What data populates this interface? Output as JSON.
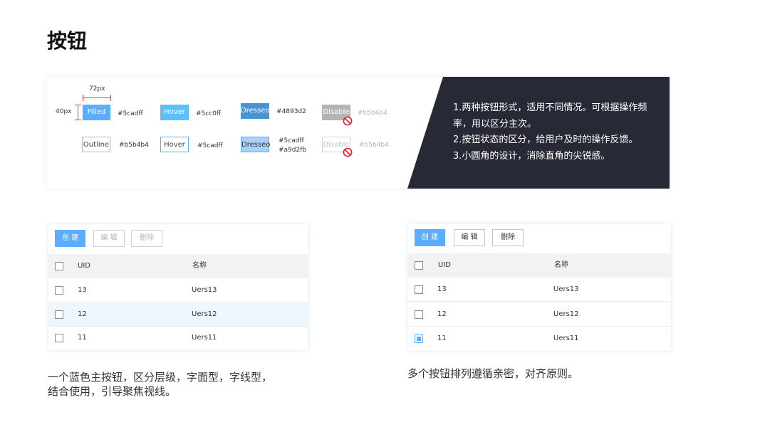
{
  "page": {
    "title": "按钮"
  },
  "spec": {
    "width_label": "72px",
    "height_label": "40px",
    "filled_row": [
      {
        "label": "Filled",
        "color": "#5cadff"
      },
      {
        "label": "Hover",
        "color": "#5cc0ff"
      },
      {
        "label": "Dresseo",
        "color": "#4893d2"
      },
      {
        "label": "Disable",
        "color": "#b5b4b4"
      }
    ],
    "outline_row": [
      {
        "label": "Outline",
        "color": "#b5b4b4"
      },
      {
        "label": "Hover",
        "color": "#5cadff"
      },
      {
        "label": "Dresseo",
        "color": "#5cadff",
        "color2": "#a9d2fb"
      },
      {
        "label": "Disable",
        "color": "#b5b4b4"
      }
    ],
    "notes": [
      "1.两种按钮形式，适用不同情况。可根据操作频",
      "率，用以区分主次。",
      "2.按钮状态的区分，给用户及时的操作反馈。",
      "3.小圆角的设计，消除直角的尖锐感。"
    ]
  },
  "table_left": {
    "toolbar": {
      "create": "创 建",
      "edit": "编 辑",
      "delete": "删除"
    },
    "columns": [
      "UID",
      "名称"
    ],
    "rows": [
      {
        "uid": "13",
        "name": "Uers13",
        "checked": false
      },
      {
        "uid": "12",
        "name": "Uers12",
        "checked": false
      },
      {
        "uid": "11",
        "name": "Uers11",
        "checked": false
      }
    ],
    "caption": [
      "一个蓝色主按钮，区分层级，字面型，字线型，",
      "结合使用，引导聚焦视线。"
    ]
  },
  "table_right": {
    "toolbar": {
      "create": "创 建",
      "edit": "编 辑",
      "delete": "删除"
    },
    "columns": [
      "UID",
      "名称"
    ],
    "rows": [
      {
        "uid": "13",
        "name": "Uers13",
        "checked": false
      },
      {
        "uid": "12",
        "name": "Uers12",
        "checked": false
      },
      {
        "uid": "11",
        "name": "Uers11",
        "checked": true
      }
    ],
    "caption": [
      "多个按钮排列遵循亲密，对齐原则。"
    ]
  },
  "colors": {
    "accent": "#5cadff",
    "dark_panel": "#272a36",
    "ban_red": "#e0202a"
  }
}
